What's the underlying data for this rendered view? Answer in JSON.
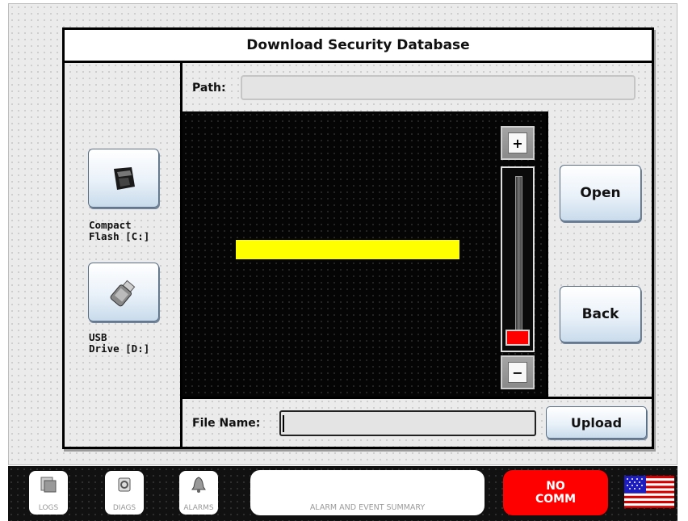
{
  "dialog": {
    "title": "Download Security Database",
    "path_label": "Path:",
    "path_value": "",
    "file_label": "File Name:",
    "file_value": ""
  },
  "drives": [
    {
      "label": "Compact\nFlash [C:]",
      "icon": "compact-flash-icon"
    },
    {
      "label": "USB\nDrive [D:]",
      "icon": "usb-drive-icon"
    }
  ],
  "buttons": {
    "open": "Open",
    "back": "Back",
    "upload": "Upload",
    "plus": "+",
    "minus": "−"
  },
  "slider": {
    "level": 0.0
  },
  "taskbar": {
    "logs": "LOGS",
    "diags": "DIAGS",
    "alarms": "ALARMS",
    "summary": "ALARM AND EVENT SUMMARY",
    "nocomm_line1": "NO",
    "nocomm_line2": "COMM"
  },
  "colors": {
    "progress": "#ffff00",
    "slider_thumb": "#ff0000",
    "status_red": "#ff0000"
  }
}
